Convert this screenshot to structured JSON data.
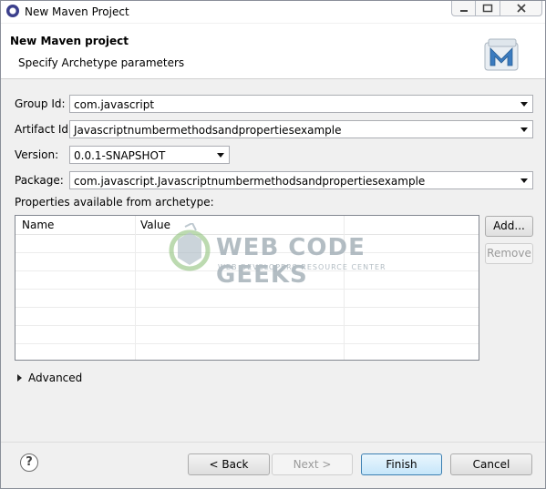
{
  "window": {
    "title": "New Maven Project"
  },
  "header": {
    "title": "New Maven project",
    "subtitle": "Specify Archetype parameters"
  },
  "form": {
    "group_id_label": "Group Id:",
    "group_id_value": "com.javascript",
    "artifact_id_label": "Artifact Id:",
    "artifact_id_value": "Javascriptnumbermethodsandpropertiesexample",
    "version_label": "Version:",
    "version_value": "0.0.1-SNAPSHOT",
    "package_label": "Package:",
    "package_value": "com.javascript.Javascriptnumbermethodsandpropertiesexample"
  },
  "properties": {
    "label": "Properties available from archetype:",
    "columns": [
      "Name",
      "Value"
    ],
    "add_label": "Add...",
    "remove_label": "Remove"
  },
  "advanced": {
    "label": "Advanced"
  },
  "footer": {
    "back_label": "< Back",
    "next_label": "Next >",
    "finish_label": "Finish",
    "cancel_label": "Cancel"
  },
  "watermark": {
    "title": "WEB CODE GEEKS",
    "subtitle": "WEB DEVELOPERS RESOURCE CENTER"
  },
  "colors": {
    "accent": "#3c7fb1",
    "maven_logo": "#3b7bbf"
  },
  "icons": {
    "app": "eclipse-icon",
    "help": "help-icon",
    "logo": "maven-logo-icon"
  }
}
